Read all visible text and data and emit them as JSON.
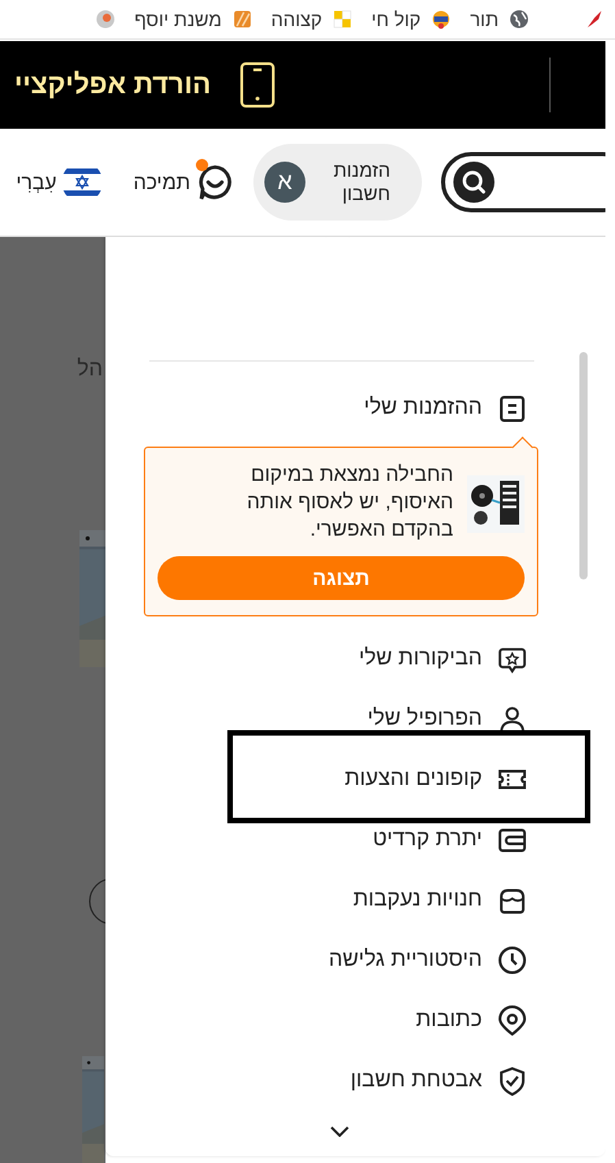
{
  "bookmarks": [
    {
      "label": "תור"
    },
    {
      "label": "קול חי"
    },
    {
      "label": "קצוהה"
    },
    {
      "label": "משנת יוסף"
    }
  ],
  "banner": {
    "title": "הורדת אפליקציי"
  },
  "header": {
    "account": {
      "avatar": "א",
      "label": "הזמנות חשבון"
    },
    "support": {
      "label": "תמיכה",
      "notification": true
    },
    "language": {
      "label": "עִבְרִי"
    }
  },
  "background": {
    "text": "הל"
  },
  "menu": {
    "items": [
      {
        "kind": "link",
        "label": "ההזמנות שלי",
        "highlighted": false
      },
      {
        "kind": "promo",
        "text": "החבילה נמצאת במיקום האיסוף, יש לאסוף אותה בהקדם האפשרי.",
        "button": "תצוגה"
      },
      {
        "kind": "link",
        "label": "הביקורות שלי",
        "highlighted": false
      },
      {
        "kind": "link",
        "label": "הפרופיל שלי",
        "highlighted": false
      },
      {
        "kind": "link",
        "label": "קופונים והצעות",
        "highlighted": true
      },
      {
        "kind": "link",
        "label": "יתרת קרדיט",
        "highlighted": false
      },
      {
        "kind": "link",
        "label": "חנויות נעקבות",
        "highlighted": false
      },
      {
        "kind": "link",
        "label": "היסטוריית גלישה",
        "highlighted": false
      },
      {
        "kind": "link",
        "label": "כתובות",
        "highlighted": false
      },
      {
        "kind": "link",
        "label": "אבטחת חשבון",
        "highlighted": false
      }
    ]
  }
}
